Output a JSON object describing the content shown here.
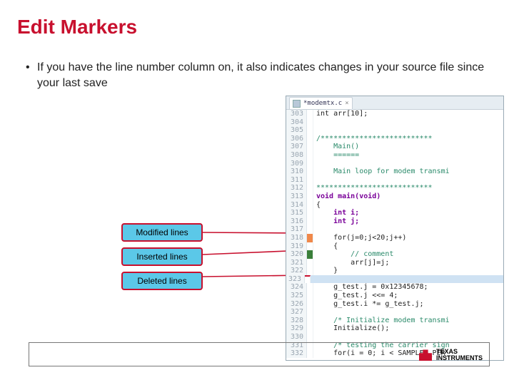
{
  "title": "Edit Markers",
  "bullet": "If you have the line number column on, it also indicates changes in your source file since your last save",
  "legend": {
    "modified": "Modified lines",
    "inserted": "Inserted lines",
    "deleted": "Deleted lines"
  },
  "editor": {
    "tab_label": "*modemtx.c",
    "lines": [
      {
        "n": "303",
        "marker": "",
        "cls": "",
        "text": "int arr[10];"
      },
      {
        "n": "304",
        "marker": "",
        "cls": "",
        "text": ""
      },
      {
        "n": "305",
        "marker": "",
        "cls": "",
        "text": ""
      },
      {
        "n": "306",
        "marker": "",
        "cls": "cm",
        "text": "/**************************"
      },
      {
        "n": "307",
        "marker": "",
        "cls": "cm",
        "text": "    Main()"
      },
      {
        "n": "308",
        "marker": "",
        "cls": "cm",
        "text": "    ======"
      },
      {
        "n": "309",
        "marker": "",
        "cls": "cm",
        "text": ""
      },
      {
        "n": "310",
        "marker": "",
        "cls": "cm",
        "text": "    Main loop for modem transmi"
      },
      {
        "n": "311",
        "marker": "",
        "cls": "cm",
        "text": ""
      },
      {
        "n": "312",
        "marker": "",
        "cls": "cm",
        "text": "***************************"
      },
      {
        "n": "313",
        "marker": "",
        "cls": "kw",
        "text": "void main(void)"
      },
      {
        "n": "314",
        "marker": "",
        "cls": "",
        "text": "{"
      },
      {
        "n": "315",
        "marker": "",
        "cls": "kw",
        "text": "    int i;"
      },
      {
        "n": "316",
        "marker": "",
        "cls": "kw",
        "text": "    int j;"
      },
      {
        "n": "317",
        "marker": "",
        "cls": "",
        "text": ""
      },
      {
        "n": "318",
        "marker": "mod",
        "cls": "",
        "text": "    for(j=0;j<20;j++)"
      },
      {
        "n": "319",
        "marker": "",
        "cls": "",
        "text": "    {"
      },
      {
        "n": "320",
        "marker": "ins",
        "cls": "cm",
        "text": "        // comment"
      },
      {
        "n": "321",
        "marker": "",
        "cls": "",
        "text": "        arr[j]=j;"
      },
      {
        "n": "322",
        "marker": "",
        "cls": "",
        "text": "    }"
      },
      {
        "n": "323",
        "marker": "del",
        "cls": "hl",
        "text": ""
      },
      {
        "n": "324",
        "marker": "",
        "cls": "",
        "text": "    g_test.j = 0x12345678;"
      },
      {
        "n": "325",
        "marker": "",
        "cls": "",
        "text": "    g_test.j <<= 4;"
      },
      {
        "n": "326",
        "marker": "",
        "cls": "",
        "text": "    g_test.i *= g_test.j;"
      },
      {
        "n": "327",
        "marker": "",
        "cls": "",
        "text": ""
      },
      {
        "n": "328",
        "marker": "",
        "cls": "cm",
        "text": "    /* Initialize modem transmi"
      },
      {
        "n": "329",
        "marker": "",
        "cls": "",
        "text": "    Initialize();"
      },
      {
        "n": "330",
        "marker": "",
        "cls": "",
        "text": ""
      },
      {
        "n": "331",
        "marker": "",
        "cls": "cm",
        "text": "    /* testing the carrier sign"
      },
      {
        "n": "332",
        "marker": "",
        "cls": "",
        "text": "    for(i = 0; i < SAMPLES_PER_"
      }
    ]
  },
  "footer": {
    "brand_line1": "TEXAS",
    "brand_line2": "INSTRUMENTS"
  }
}
